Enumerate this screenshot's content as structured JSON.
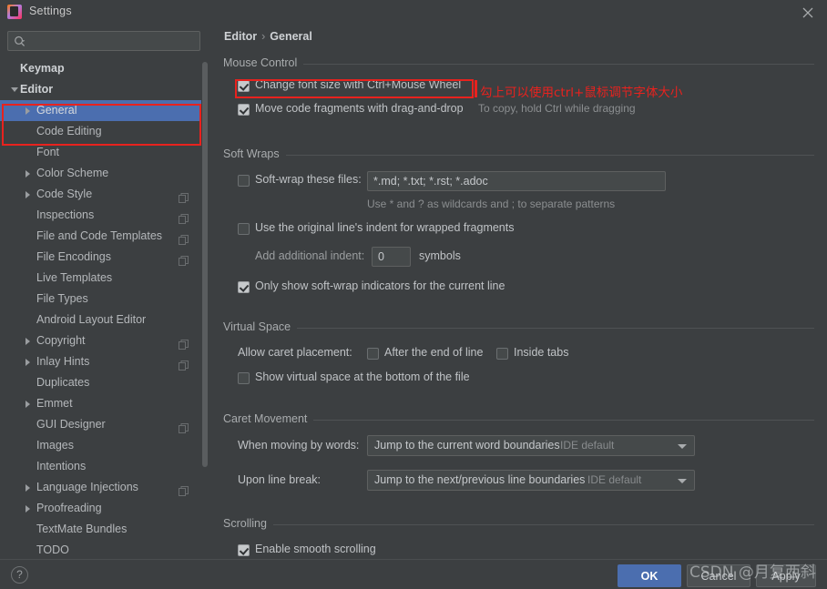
{
  "window": {
    "title": "Settings",
    "icon": "intellij-idea-icon",
    "close_label": "✕"
  },
  "sidebar": {
    "search": {
      "placeholder": "",
      "value": "",
      "icon": "search-icon"
    },
    "items": [
      {
        "label": "Keymap",
        "level": 0,
        "arrow": "none",
        "bold": true,
        "selected": false,
        "copyable": false
      },
      {
        "label": "Editor",
        "level": 0,
        "arrow": "expanded",
        "bold": true,
        "selected": false,
        "copyable": false
      },
      {
        "label": "General",
        "level": 1,
        "arrow": "collapsed",
        "bold": false,
        "selected": true,
        "copyable": false
      },
      {
        "label": "Code Editing",
        "level": 1,
        "arrow": "none",
        "bold": false,
        "selected": false,
        "copyable": false
      },
      {
        "label": "Font",
        "level": 1,
        "arrow": "none",
        "bold": false,
        "selected": false,
        "copyable": false
      },
      {
        "label": "Color Scheme",
        "level": 1,
        "arrow": "collapsed",
        "bold": false,
        "selected": false,
        "copyable": false
      },
      {
        "label": "Code Style",
        "level": 1,
        "arrow": "collapsed",
        "bold": false,
        "selected": false,
        "copyable": true
      },
      {
        "label": "Inspections",
        "level": 1,
        "arrow": "none",
        "bold": false,
        "selected": false,
        "copyable": true
      },
      {
        "label": "File and Code Templates",
        "level": 1,
        "arrow": "none",
        "bold": false,
        "selected": false,
        "copyable": true
      },
      {
        "label": "File Encodings",
        "level": 1,
        "arrow": "none",
        "bold": false,
        "selected": false,
        "copyable": true
      },
      {
        "label": "Live Templates",
        "level": 1,
        "arrow": "none",
        "bold": false,
        "selected": false,
        "copyable": false
      },
      {
        "label": "File Types",
        "level": 1,
        "arrow": "none",
        "bold": false,
        "selected": false,
        "copyable": false
      },
      {
        "label": "Android Layout Editor",
        "level": 1,
        "arrow": "none",
        "bold": false,
        "selected": false,
        "copyable": false
      },
      {
        "label": "Copyright",
        "level": 1,
        "arrow": "collapsed",
        "bold": false,
        "selected": false,
        "copyable": true
      },
      {
        "label": "Inlay Hints",
        "level": 1,
        "arrow": "collapsed",
        "bold": false,
        "selected": false,
        "copyable": true
      },
      {
        "label": "Duplicates",
        "level": 1,
        "arrow": "none",
        "bold": false,
        "selected": false,
        "copyable": false
      },
      {
        "label": "Emmet",
        "level": 1,
        "arrow": "collapsed",
        "bold": false,
        "selected": false,
        "copyable": false
      },
      {
        "label": "GUI Designer",
        "level": 1,
        "arrow": "none",
        "bold": false,
        "selected": false,
        "copyable": true
      },
      {
        "label": "Images",
        "level": 1,
        "arrow": "none",
        "bold": false,
        "selected": false,
        "copyable": false
      },
      {
        "label": "Intentions",
        "level": 1,
        "arrow": "none",
        "bold": false,
        "selected": false,
        "copyable": false
      },
      {
        "label": "Language Injections",
        "level": 1,
        "arrow": "collapsed",
        "bold": false,
        "selected": false,
        "copyable": true
      },
      {
        "label": "Proofreading",
        "level": 1,
        "arrow": "collapsed",
        "bold": false,
        "selected": false,
        "copyable": false
      },
      {
        "label": "TextMate Bundles",
        "level": 1,
        "arrow": "none",
        "bold": false,
        "selected": false,
        "copyable": false
      },
      {
        "label": "TODO",
        "level": 1,
        "arrow": "none",
        "bold": false,
        "selected": false,
        "copyable": false
      }
    ]
  },
  "breadcrumb": {
    "parent": "Editor",
    "separator": "›",
    "current": "General"
  },
  "sections": {
    "mouse_control": {
      "title": "Mouse Control",
      "change_font_size": {
        "label": "Change font size with Ctrl+Mouse Wheel",
        "checked": true
      },
      "move_fragments": {
        "label": "Move code fragments with drag-and-drop",
        "checked": true
      },
      "move_fragments_hint": "To copy, hold Ctrl while dragging",
      "annotation": "勾上可以使用ctrl+鼠标调节字体大小"
    },
    "soft_wraps": {
      "title": "Soft Wraps",
      "soft_wrap_files": {
        "label": "Soft-wrap these files:",
        "checked": false
      },
      "soft_wrap_value": "*.md; *.txt; *.rst; *.adoc",
      "wildcard_hint": "Use * and ? as wildcards and ; to separate patterns",
      "original_indent": {
        "label": "Use the original line's indent for wrapped fragments",
        "checked": false
      },
      "additional_indent_label": "Add additional indent:",
      "additional_indent_value": "0",
      "symbols_label": "symbols",
      "only_show_indicators": {
        "label": "Only show soft-wrap indicators for the current line",
        "checked": true
      }
    },
    "virtual_space": {
      "title": "Virtual Space",
      "allow_caret_label": "Allow caret placement:",
      "after_end_of_line": {
        "label": "After the end of line",
        "checked": false
      },
      "inside_tabs": {
        "label": "Inside tabs",
        "checked": false
      },
      "show_virtual_space": {
        "label": "Show virtual space at the bottom of the file",
        "checked": false
      }
    },
    "caret_movement": {
      "title": "Caret Movement",
      "when_moving_label": "When moving by words:",
      "when_moving_value": "Jump to the current word boundaries",
      "when_moving_default": "IDE default",
      "upon_line_break_label": "Upon line break:",
      "upon_line_break_value": "Jump to the next/previous line boundaries",
      "upon_line_break_default": "IDE default"
    },
    "scrolling": {
      "title": "Scrolling",
      "smooth_scrolling": {
        "label": "Enable smooth scrolling",
        "checked": true
      }
    }
  },
  "footer": {
    "help": "?",
    "ok": "OK",
    "cancel": "Cancel",
    "apply": "Apply"
  },
  "watermark": "CSDN @月复西斜",
  "colors": {
    "background": "#3c3f41",
    "selection": "#4b6eaf",
    "annotation_red": "#e8221e",
    "text": "#bbbbbb",
    "field_background": "#45494a"
  }
}
